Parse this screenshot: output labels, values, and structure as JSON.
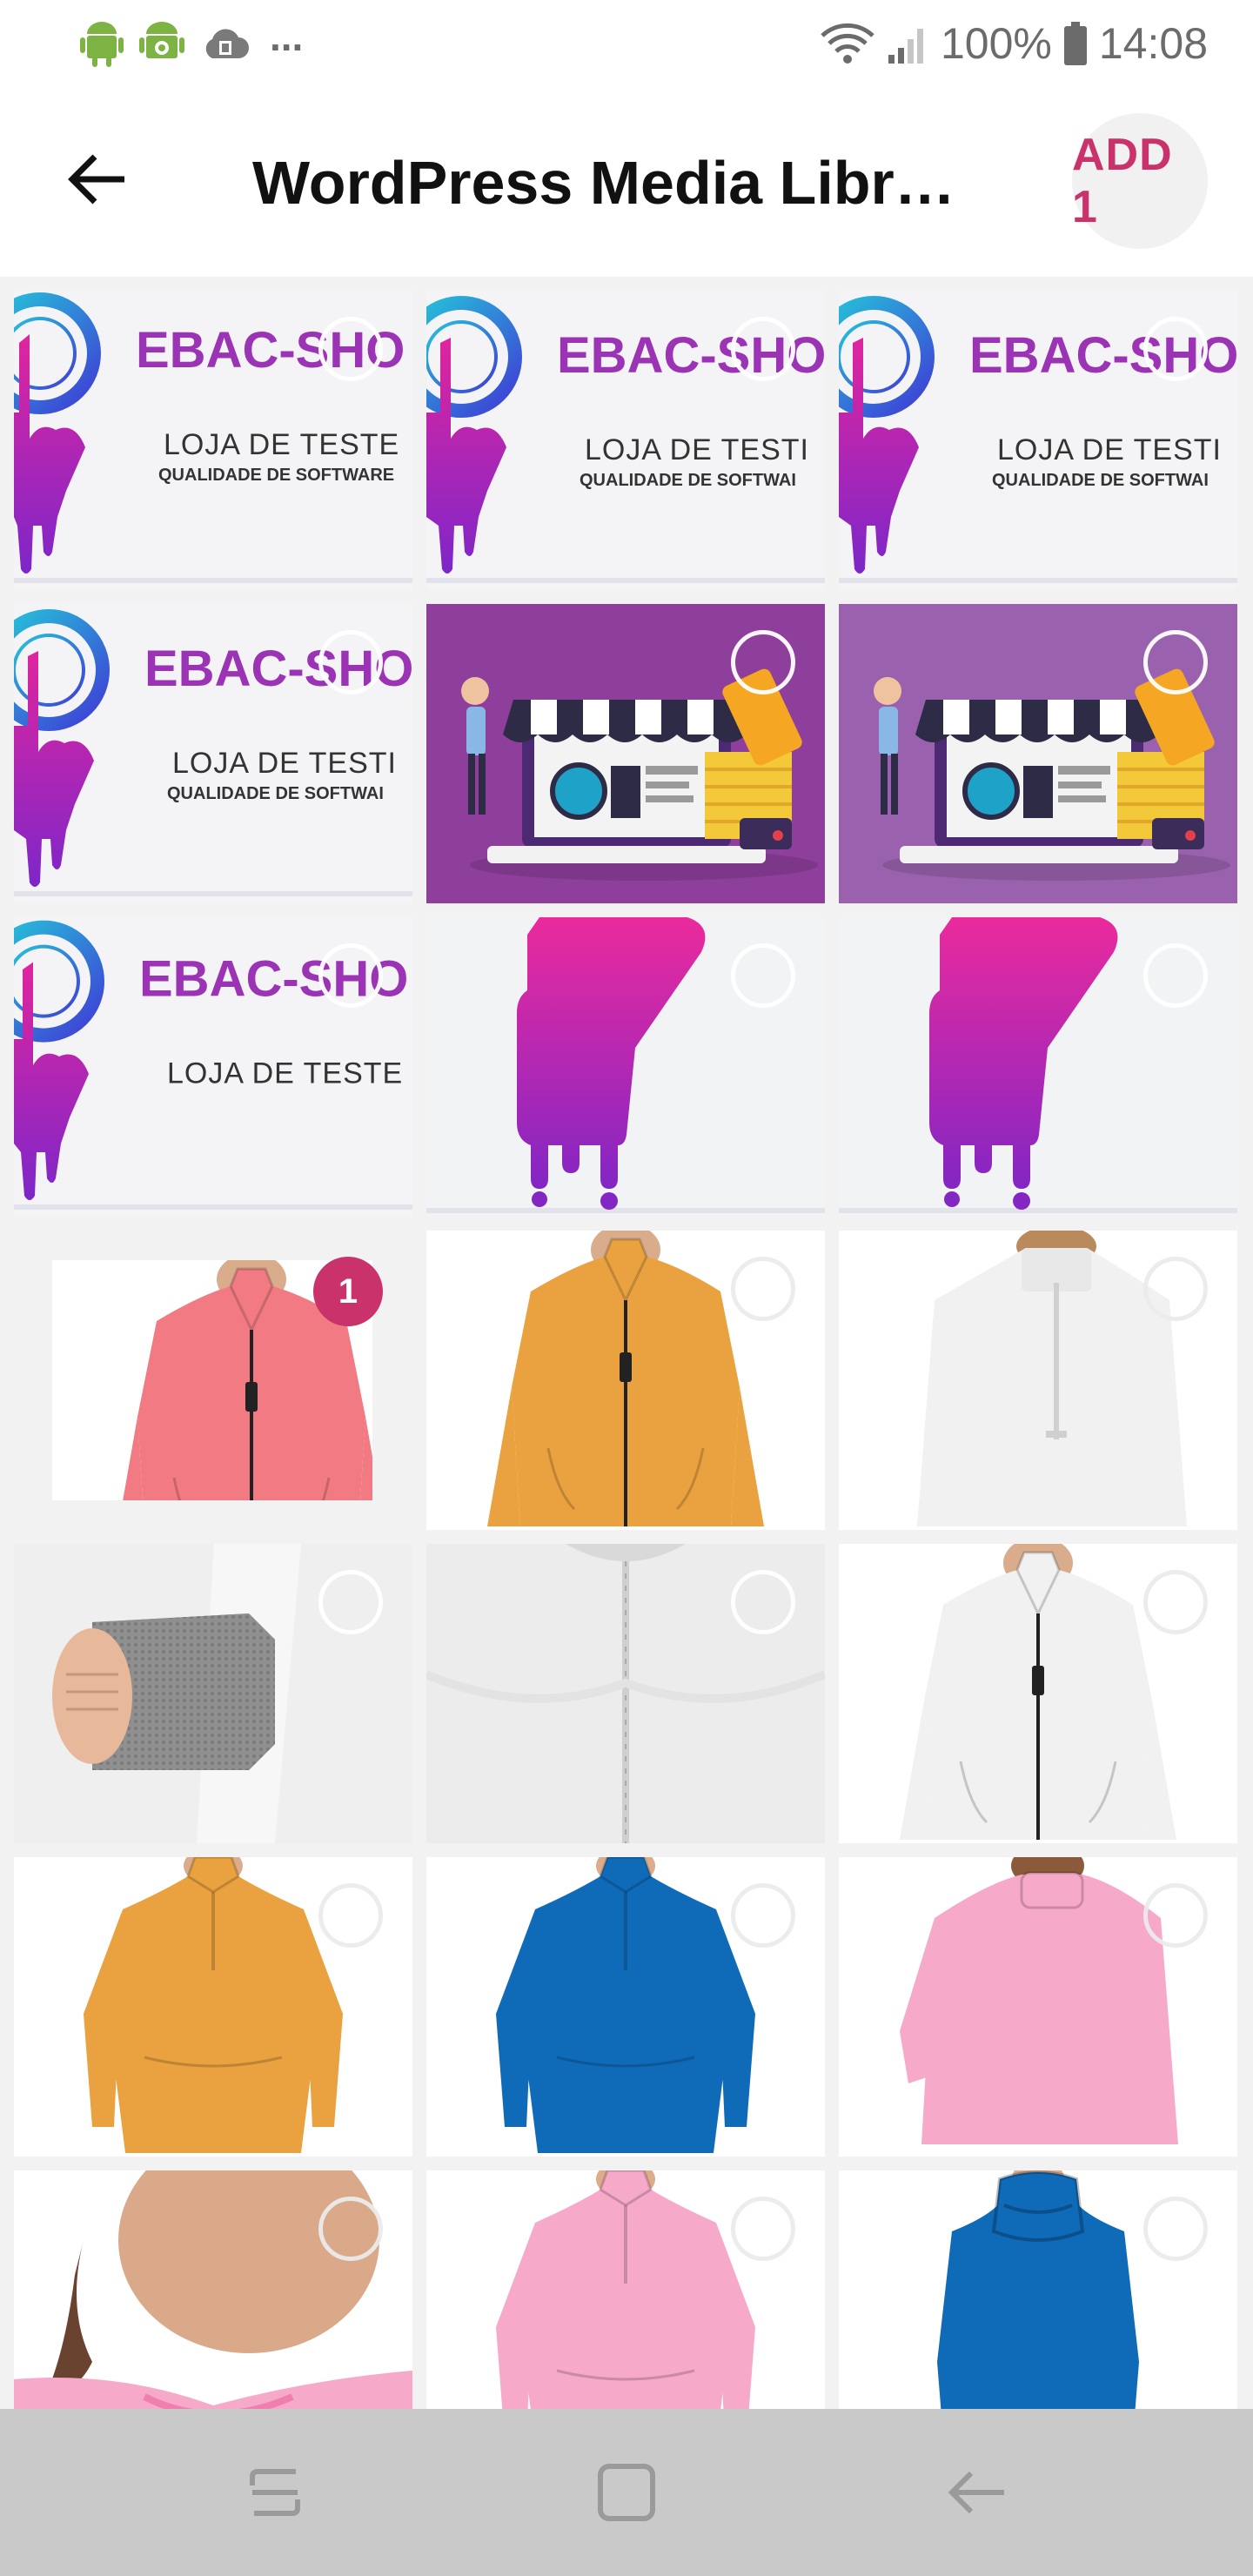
{
  "status_bar": {
    "battery": "100%",
    "time": "14:08",
    "overflow": "...",
    "icons": [
      "android-icon",
      "android-debug-icon",
      "cloud-sync-icon",
      "wifi-icon",
      "signal-icon",
      "battery-icon"
    ]
  },
  "app_bar": {
    "title": "WordPress Media Libr…",
    "add_label": "ADD 1",
    "back_icon": "arrow-back-icon"
  },
  "colors": {
    "accent": "#c9326b",
    "brand_purple": "#9b33b5",
    "navbar": "#c9c9c9"
  },
  "media_items": [
    {
      "kind": "logo",
      "brand": "EBAC-SHO",
      "line1": "LOJA DE TESTE",
      "line2": "QUALIDADE DE SOFTWARE",
      "selected": false
    },
    {
      "kind": "logo",
      "brand": "EBAC-SHO",
      "line1": "LOJA DE TESTI",
      "line2": "QUALIDADE DE SOFTWAI",
      "selected": false
    },
    {
      "kind": "logo",
      "brand": "EBAC-SHO",
      "line1": "LOJA DE TESTI",
      "line2": "QUALIDADE DE SOFTWAI",
      "selected": false
    },
    {
      "kind": "logo",
      "brand": "EBAC-SHO",
      "line1": "LOJA DE TESTI",
      "line2": "QUALIDADE DE SOFTWAI",
      "selected": false
    },
    {
      "kind": "shop-illustration",
      "selected": false
    },
    {
      "kind": "shop-illustration",
      "selected": false
    },
    {
      "kind": "logo",
      "brand": "EBAC-SHO",
      "line1": "LOJA DE TESTE",
      "line2": "",
      "selected": false
    },
    {
      "kind": "hand-icon",
      "selected": false
    },
    {
      "kind": "hand-icon",
      "selected": false
    },
    {
      "kind": "jacket",
      "color": "coral",
      "selected": true,
      "badge": "1"
    },
    {
      "kind": "jacket",
      "color": "orange",
      "selected": false
    },
    {
      "kind": "jacket-back",
      "color": "white",
      "selected": false
    },
    {
      "kind": "sleeve-detail",
      "color": "white",
      "selected": false
    },
    {
      "kind": "back-detail",
      "color": "white",
      "selected": false
    },
    {
      "kind": "jacket",
      "color": "white",
      "selected": false
    },
    {
      "kind": "pullover",
      "color": "orange",
      "selected": false
    },
    {
      "kind": "pullover",
      "color": "blue",
      "selected": false
    },
    {
      "kind": "pullover-back",
      "color": "pink",
      "selected": false
    },
    {
      "kind": "collar-detail",
      "color": "pink",
      "selected": false
    },
    {
      "kind": "pullover",
      "color": "pink",
      "selected": false
    },
    {
      "kind": "turtleneck",
      "color": "blue",
      "selected": false
    }
  ],
  "nav_bar": {
    "buttons": [
      "recents-icon",
      "home-icon",
      "back-nav-icon"
    ]
  }
}
